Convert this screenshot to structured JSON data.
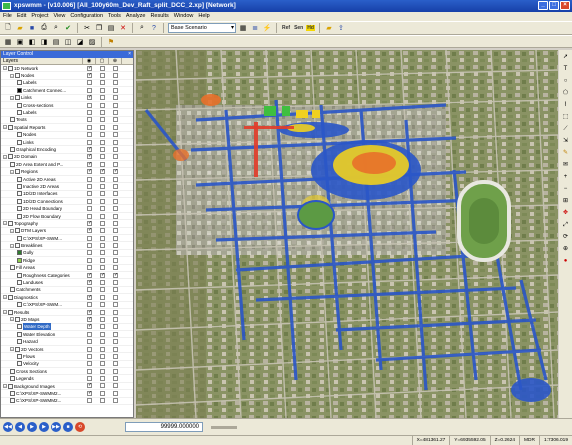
{
  "window": {
    "title": "xpswmm - [v10.006] [All_100y60m_Dev_Raft_split_DCC_2.xp] [Network]"
  },
  "menu": [
    "File",
    "Edit",
    "Project",
    "View",
    "Configuration",
    "Tools",
    "Analyze",
    "Results",
    "Window",
    "Help"
  ],
  "toolbar": {
    "scenario": "Base Scenario",
    "ref_label": "Ref",
    "sen_label": "Sen",
    "hyd_label": "Hd"
  },
  "layer_control": {
    "title": "Layer Control",
    "header": "Layers",
    "rows": [
      {
        "label": "1D Network",
        "indent": 0,
        "exp": "-",
        "c1": true,
        "c2": false,
        "c3": false
      },
      {
        "label": "Nodes",
        "indent": 1,
        "exp": "-",
        "c1": true,
        "c2": false,
        "c3": false
      },
      {
        "label": "Labels",
        "indent": 2,
        "exp": "",
        "c1": false,
        "c2": false,
        "c3": false
      },
      {
        "label": "Catchment Connec...",
        "indent": 2,
        "exp": "",
        "c1": false,
        "c2": false,
        "c3": false,
        "swatch": "#000000"
      },
      {
        "label": "Links",
        "indent": 1,
        "exp": "-",
        "c1": true,
        "c2": false,
        "c3": false
      },
      {
        "label": "Cross-sections",
        "indent": 2,
        "exp": "",
        "c1": false,
        "c2": false,
        "c3": false
      },
      {
        "label": "Labels",
        "indent": 2,
        "exp": "",
        "c1": false,
        "c2": false,
        "c3": false
      },
      {
        "label": "Texts",
        "indent": 1,
        "exp": "",
        "c1": false,
        "c2": false,
        "c3": false
      },
      {
        "label": "Spatial Reports",
        "indent": 0,
        "exp": "-",
        "c1": false,
        "c2": false,
        "c3": false
      },
      {
        "label": "Nodes",
        "indent": 2,
        "exp": "",
        "c1": false,
        "c2": false,
        "c3": false
      },
      {
        "label": "Links",
        "indent": 2,
        "exp": "",
        "c1": false,
        "c2": false,
        "c3": false
      },
      {
        "label": "Graphical Encoding",
        "indent": 1,
        "exp": "",
        "c1": true,
        "c2": false,
        "c3": false
      },
      {
        "label": "2D Domain",
        "indent": 0,
        "exp": "-",
        "c1": true,
        "c2": false,
        "c3": false
      },
      {
        "label": "2D Area Extent and P...",
        "indent": 1,
        "exp": "",
        "c1": true,
        "c2": false,
        "c3": false
      },
      {
        "label": "Regions",
        "indent": 1,
        "exp": "-",
        "c1": true,
        "c2": true,
        "c3": true
      },
      {
        "label": "Active 2D Areas",
        "indent": 2,
        "exp": "",
        "c1": false,
        "c2": false,
        "c3": false
      },
      {
        "label": "Inactive 2D Areas",
        "indent": 2,
        "exp": "",
        "c1": false,
        "c2": false,
        "c3": false
      },
      {
        "label": "1D/2D Interfaces",
        "indent": 2,
        "exp": "",
        "c1": false,
        "c2": false,
        "c3": false
      },
      {
        "label": "1D/2D Connections",
        "indent": 2,
        "exp": "",
        "c1": false,
        "c2": false,
        "c3": false
      },
      {
        "label": "2D Head Boundary",
        "indent": 2,
        "exp": "",
        "c1": false,
        "c2": false,
        "c3": false
      },
      {
        "label": "2D Flow Boundary",
        "indent": 2,
        "exp": "",
        "c1": false,
        "c2": false,
        "c3": false
      },
      {
        "label": "Topography",
        "indent": 0,
        "exp": "-",
        "c1": true,
        "c2": false,
        "c3": false
      },
      {
        "label": "DTM Layers",
        "indent": 1,
        "exp": "-",
        "c1": true,
        "c2": false,
        "c3": false
      },
      {
        "label": "C:\\XPS\\XP-SWM...",
        "indent": 2,
        "exp": "",
        "c1": false,
        "c2": false,
        "c3": false
      },
      {
        "label": "Breaklines",
        "indent": 1,
        "exp": "-",
        "c1": false,
        "c2": false,
        "c3": false
      },
      {
        "label": "Gully",
        "indent": 2,
        "exp": "",
        "c1": false,
        "c2": false,
        "c3": false,
        "swatch": "#2f7d2f"
      },
      {
        "label": "Ridge",
        "indent": 2,
        "exp": "",
        "c1": false,
        "c2": false,
        "c3": false,
        "swatch": "#8fd04a"
      },
      {
        "label": "Fill Areas",
        "indent": 1,
        "exp": "",
        "c1": false,
        "c2": false,
        "c3": false
      },
      {
        "label": "Roughness Categories",
        "indent": 2,
        "exp": "",
        "c1": true,
        "c2": true,
        "c3": true
      },
      {
        "label": "Landuses",
        "indent": 2,
        "exp": "",
        "c1": true,
        "c2": false,
        "c3": false
      },
      {
        "label": "Catchments",
        "indent": 1,
        "exp": "",
        "c1": false,
        "c2": false,
        "c3": false
      },
      {
        "label": "Diagnostics",
        "indent": 0,
        "exp": "-",
        "c1": true,
        "c2": false,
        "c3": false
      },
      {
        "label": "C:\\XPS\\XP-SWM...",
        "indent": 2,
        "exp": "",
        "c1": false,
        "c2": false,
        "c3": false
      },
      {
        "label": "Results",
        "indent": 0,
        "exp": "-",
        "c1": true,
        "c2": false,
        "c3": false
      },
      {
        "label": "2D Maps",
        "indent": 1,
        "exp": "-",
        "c1": true,
        "c2": false,
        "c3": false
      },
      {
        "label": "Water Depth",
        "indent": 2,
        "exp": "",
        "c1": true,
        "c2": false,
        "c3": false,
        "selected": true
      },
      {
        "label": "Water Elevation",
        "indent": 2,
        "exp": "",
        "c1": false,
        "c2": false,
        "c3": false
      },
      {
        "label": "Hazard",
        "indent": 2,
        "exp": "",
        "c1": false,
        "c2": false,
        "c3": false
      },
      {
        "label": "2D Vectors",
        "indent": 1,
        "exp": "-",
        "c1": false,
        "c2": false,
        "c3": false
      },
      {
        "label": "Flows",
        "indent": 2,
        "exp": "",
        "c1": false,
        "c2": false,
        "c3": false
      },
      {
        "label": "Velocity",
        "indent": 2,
        "exp": "",
        "c1": false,
        "c2": false,
        "c3": false
      },
      {
        "label": "Cross Sections",
        "indent": 1,
        "exp": "",
        "c1": false,
        "c2": false,
        "c3": false
      },
      {
        "label": "Legends",
        "indent": 1,
        "exp": "",
        "c1": false,
        "c2": false,
        "c3": false
      },
      {
        "label": "Background Images",
        "indent": 0,
        "exp": "-",
        "c1": true,
        "c2": false,
        "c3": false
      },
      {
        "label": "C:\\XPS\\XP-SWMM2...",
        "indent": 1,
        "exp": "",
        "c1": true,
        "c2": false,
        "c3": false
      },
      {
        "label": "C:\\XPS\\XP-SWMM2...",
        "indent": 1,
        "exp": "",
        "c1": false,
        "c2": false,
        "c3": false
      }
    ]
  },
  "bottom": {
    "time": "99999.000000"
  },
  "status": {
    "x": "X=481361.27",
    "y": "Y=6935592.05",
    "z": "Z=0.2624",
    "mode": "MDR",
    "scale": "1:7306.019"
  }
}
